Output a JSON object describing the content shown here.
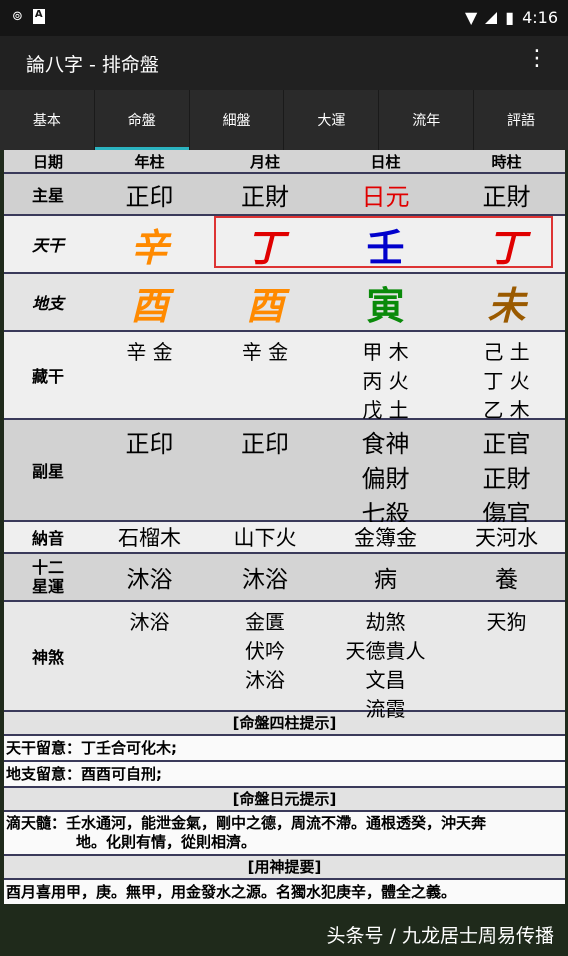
{
  "status": {
    "time": "4:16",
    "left_icon_1": "cast",
    "left_icon_2": "A"
  },
  "app": {
    "title": "論八字 - 排命盤"
  },
  "tabs": [
    "基本",
    "命盤",
    "細盤",
    "大運",
    "流年",
    "評語"
  ],
  "table": {
    "header": [
      "日期",
      "年柱",
      "月柱",
      "日柱",
      "時柱"
    ],
    "zhuxing": {
      "label": "主星",
      "values": [
        "正印",
        "正財",
        "日元",
        "正財"
      ]
    },
    "tiangan": {
      "label": "天干",
      "values": [
        "辛",
        "丁",
        "壬",
        "丁"
      ]
    },
    "dizhi": {
      "label": "地支",
      "values": [
        "酉",
        "酉",
        "寅",
        "未"
      ]
    },
    "canggan": {
      "label": "藏干",
      "values": [
        [
          "辛 金"
        ],
        [
          "辛 金"
        ],
        [
          "甲 木",
          "丙 火",
          "戊 土"
        ],
        [
          "己 土",
          "丁 火",
          "乙 木"
        ]
      ]
    },
    "fuxing": {
      "label": "副星",
      "values": [
        [
          "正印"
        ],
        [
          "正印"
        ],
        [
          "食神",
          "偏財",
          "七殺"
        ],
        [
          "正官",
          "正財",
          "傷官"
        ]
      ]
    },
    "nayin": {
      "label": "納音",
      "values": [
        "石榴木",
        "山下火",
        "金簿金",
        "天河水"
      ]
    },
    "xingyun": {
      "label1": "十二",
      "label2": "星運",
      "values": [
        "沐浴",
        "沐浴",
        "病",
        "養"
      ]
    },
    "shensha": {
      "label": "神煞",
      "values": [
        [
          "沐浴"
        ],
        [
          "金匱",
          "伏吟",
          "沐浴"
        ],
        [
          "劫煞",
          "天德貴人",
          "文昌",
          "流霞"
        ],
        [
          "天狗"
        ]
      ]
    }
  },
  "sections": {
    "sizhu_title": "[命盤四柱提示]",
    "tiangan_tip": "天干留意：丁壬合可化木;",
    "dizhi_tip": "地支留意：酉酉可自刑;",
    "riyuan_title": "[命盤日元提示]",
    "ditiansui_line1": "滴天髓：壬水通河，能泄金氣，剛中之德，周流不滯。通根透癸，沖天奔",
    "ditiansui_line2": "地。化則有情，從則相濟。",
    "yongshen_title": "[用神提要]",
    "yongshen_text": "酉月喜用甲，庚。無甲，用金發水之源。名獨水犯庚辛，體全之義。"
  },
  "watermark": "头条号 / 九龙居士周易传播",
  "colors": {
    "tiangan": [
      "#ff8a00",
      "#e00000",
      "#0000cc",
      "#e00000"
    ],
    "dizhi": [
      "#ff8a00",
      "#ff8a00",
      "#0a8a0a",
      "#9a5a00"
    ],
    "riyuan": "#e00000"
  }
}
